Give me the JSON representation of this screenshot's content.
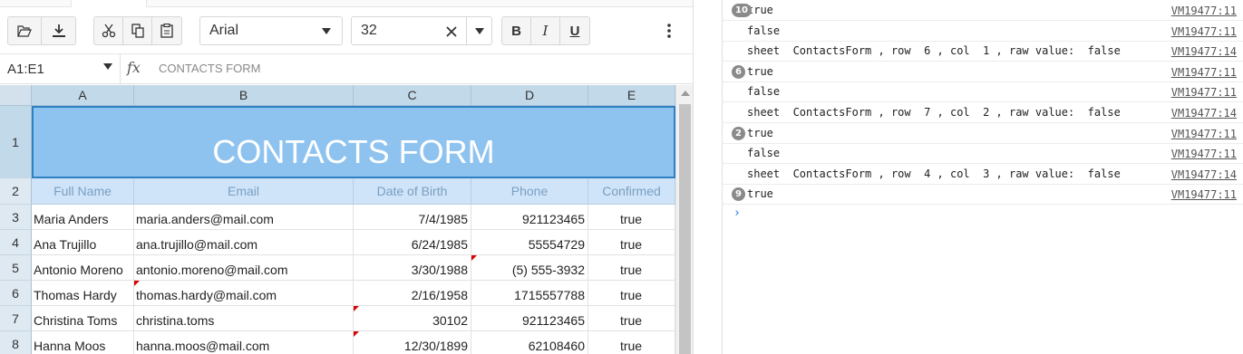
{
  "toolbar": {
    "font_family": "Arial",
    "font_size": "32",
    "bold_label": "B",
    "italic_label": "I",
    "underline_label": "U"
  },
  "formula_bar": {
    "cell_ref": "A1:E1",
    "fx": "fx",
    "value": "CONTACTS FORM"
  },
  "columns": [
    "A",
    "B",
    "C",
    "D",
    "E"
  ],
  "rows": [
    "1",
    "2",
    "3",
    "4",
    "5",
    "6",
    "7",
    "8"
  ],
  "sheet": {
    "title": "CONTACTS FORM",
    "headers": [
      "Full Name",
      "Email",
      "Date of Birth",
      "Phone",
      "Confirmed"
    ],
    "data": [
      [
        "Maria Anders",
        "maria.anders@mail.com",
        "7/4/1985",
        "921123465",
        "true"
      ],
      [
        "Ana Trujillo",
        "ana.trujillo@mail.com",
        "6/24/1985",
        "55554729",
        "true"
      ],
      [
        "Antonio Moreno",
        "antonio.moreno@mail.com",
        "3/30/1988",
        "(5) 555-3932",
        "true"
      ],
      [
        "Thomas Hardy",
        "thomas.hardy@mail.com",
        "2/16/1958",
        "1715557788",
        "true"
      ],
      [
        "Christina Toms",
        "christina.toms",
        "30102",
        "921123465",
        "true"
      ],
      [
        "Hanna Moos",
        "hanna.moos@mail.com",
        "12/30/1899",
        "62108460",
        "true"
      ]
    ]
  },
  "console": {
    "lines": [
      {
        "count": "10",
        "text": "true",
        "source": "VM19477:11"
      },
      {
        "count": "",
        "text": "false",
        "source": "VM19477:11"
      },
      {
        "count": "",
        "text": "sheet  ContactsForm , row  6 , col  1 , raw value:  false",
        "source": "VM19477:14"
      },
      {
        "count": "6",
        "text": "true",
        "source": "VM19477:11"
      },
      {
        "count": "",
        "text": "false",
        "source": "VM19477:11"
      },
      {
        "count": "",
        "text": "sheet  ContactsForm , row  7 , col  2 , raw value:  false",
        "source": "VM19477:14"
      },
      {
        "count": "2",
        "text": "true",
        "source": "VM19477:11"
      },
      {
        "count": "",
        "text": "false",
        "source": "VM19477:11"
      },
      {
        "count": "",
        "text": "sheet  ContactsForm , row  4 , col  3 , raw value:  false",
        "source": "VM19477:14"
      },
      {
        "count": "9",
        "text": "true",
        "source": "VM19477:11"
      }
    ],
    "prompt": "›"
  }
}
